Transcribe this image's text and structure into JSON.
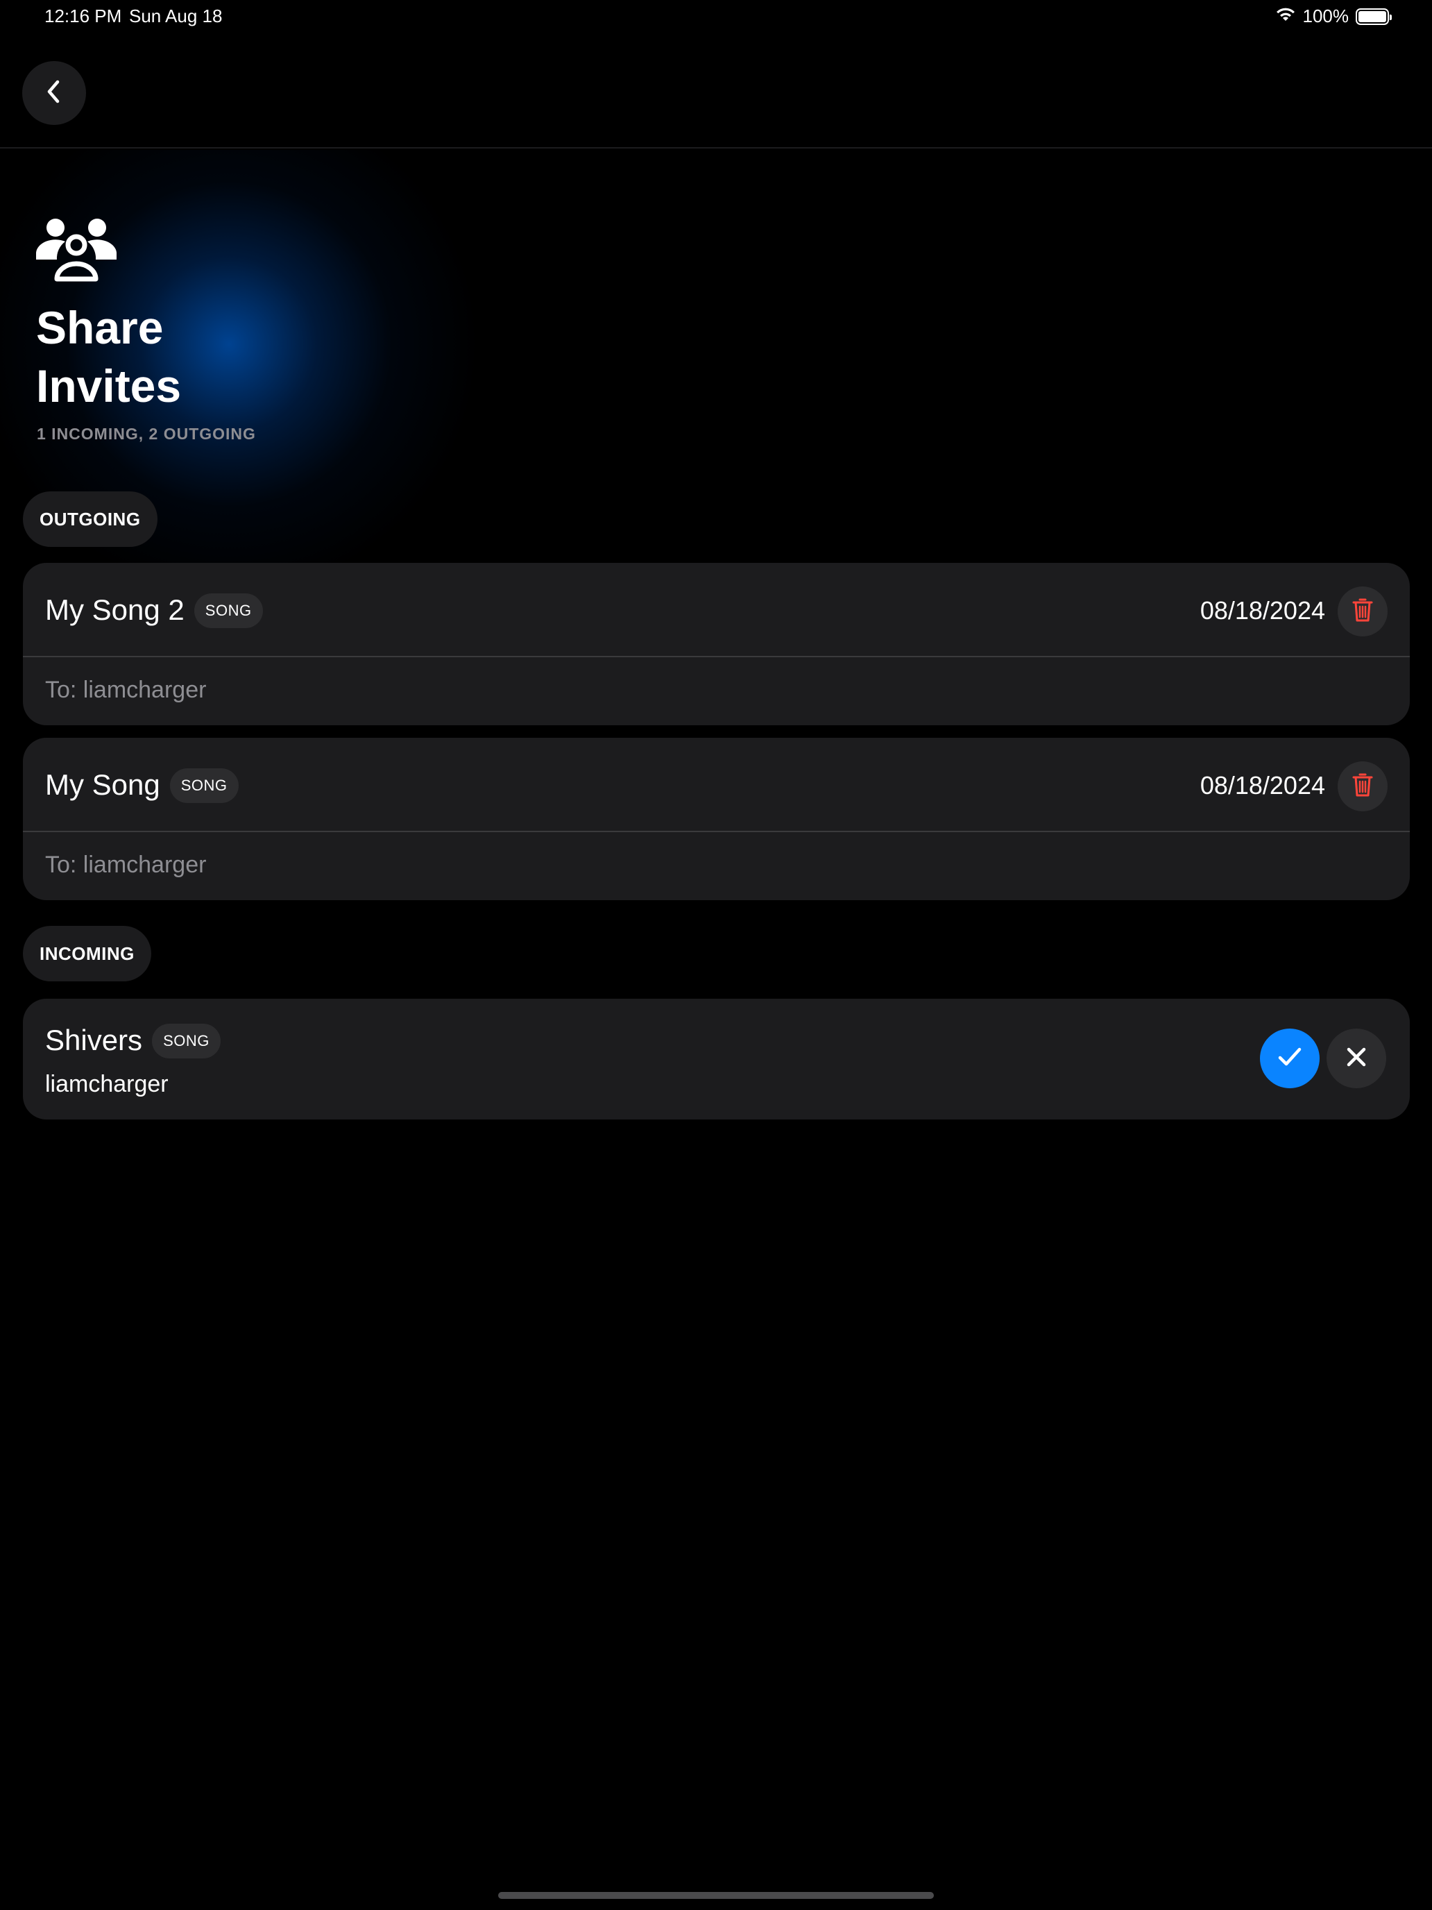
{
  "status_bar": {
    "time": "12:16 PM",
    "date": "Sun Aug 18",
    "battery_text": "100%",
    "battery_level": 1.0
  },
  "nav": {
    "back_icon": "chevron-left-icon"
  },
  "header": {
    "icon": "people-group-icon",
    "title": "Share\nInvites",
    "subtitle": "1 INCOMING, 2 OUTGOING"
  },
  "sections": {
    "outgoing_label": "OUTGOING",
    "incoming_label": "INCOMING"
  },
  "outgoing": [
    {
      "title": "My Song 2",
      "badge": "SONG",
      "date": "08/18/2024",
      "recipient": "To: liamcharger"
    },
    {
      "title": "My Song",
      "badge": "SONG",
      "date": "08/18/2024",
      "recipient": "To: liamcharger"
    }
  ],
  "incoming": [
    {
      "title": "Shivers",
      "badge": "SONG",
      "sender": "liamcharger"
    }
  ],
  "colors": {
    "accent": "#0a84ff",
    "destructive": "#ff453a",
    "card": "#1c1c1e",
    "secondary_text": "#8e8e93"
  }
}
